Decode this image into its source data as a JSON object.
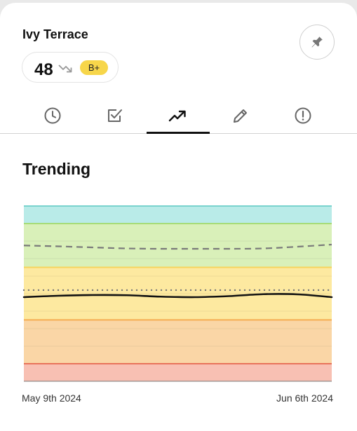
{
  "header": {
    "title": "Ivy Terrace",
    "score": "48",
    "trend_icon": "trending-down-icon",
    "grade": "B+",
    "pin_icon": "pin-icon"
  },
  "tabs": [
    {
      "id": "history",
      "icon": "clock-icon",
      "active": false
    },
    {
      "id": "tasks",
      "icon": "checkbox-icon",
      "active": false
    },
    {
      "id": "trending",
      "icon": "trending-up-icon",
      "active": true
    },
    {
      "id": "edit",
      "icon": "pencil-icon",
      "active": false
    },
    {
      "id": "alerts",
      "icon": "alert-circle-icon",
      "active": false
    }
  ],
  "section": {
    "title": "Trending"
  },
  "chart_data": {
    "type": "line",
    "x": [
      "May 9th 2024",
      "Jun 6th 2024"
    ],
    "ylim": [
      0,
      100
    ],
    "bands": [
      {
        "from": 0,
        "to": 10,
        "color": "#f8c0b3",
        "edge": "#e8735a"
      },
      {
        "from": 10,
        "to": 35,
        "color": "#fad6a6",
        "edge": "#f5ac52"
      },
      {
        "from": 35,
        "to": 65,
        "color": "#fde9a0",
        "edge": "#f6d35c"
      },
      {
        "from": 65,
        "to": 90,
        "color": "#d9f0b9",
        "edge": "#a6dc78"
      },
      {
        "from": 90,
        "to": 100,
        "color": "#b9ebe8",
        "edge": "#79d3ce"
      }
    ],
    "series": [
      {
        "style": "solid",
        "color": "#111111",
        "values": [
          48,
          48.8,
          49.2,
          49.1,
          48.3,
          48.0,
          48.6,
          49.7,
          49.6,
          48.0
        ]
      },
      {
        "style": "dotted",
        "color": "#777777",
        "values": [
          52,
          52,
          52,
          52,
          52,
          52,
          52,
          52,
          52,
          52
        ]
      },
      {
        "style": "dashed",
        "color": "#7a7a7a",
        "values": [
          77.5,
          77.0,
          76.4,
          75.8,
          75.6,
          75.6,
          75.6,
          75.8,
          76.8,
          78.0
        ]
      }
    ]
  }
}
